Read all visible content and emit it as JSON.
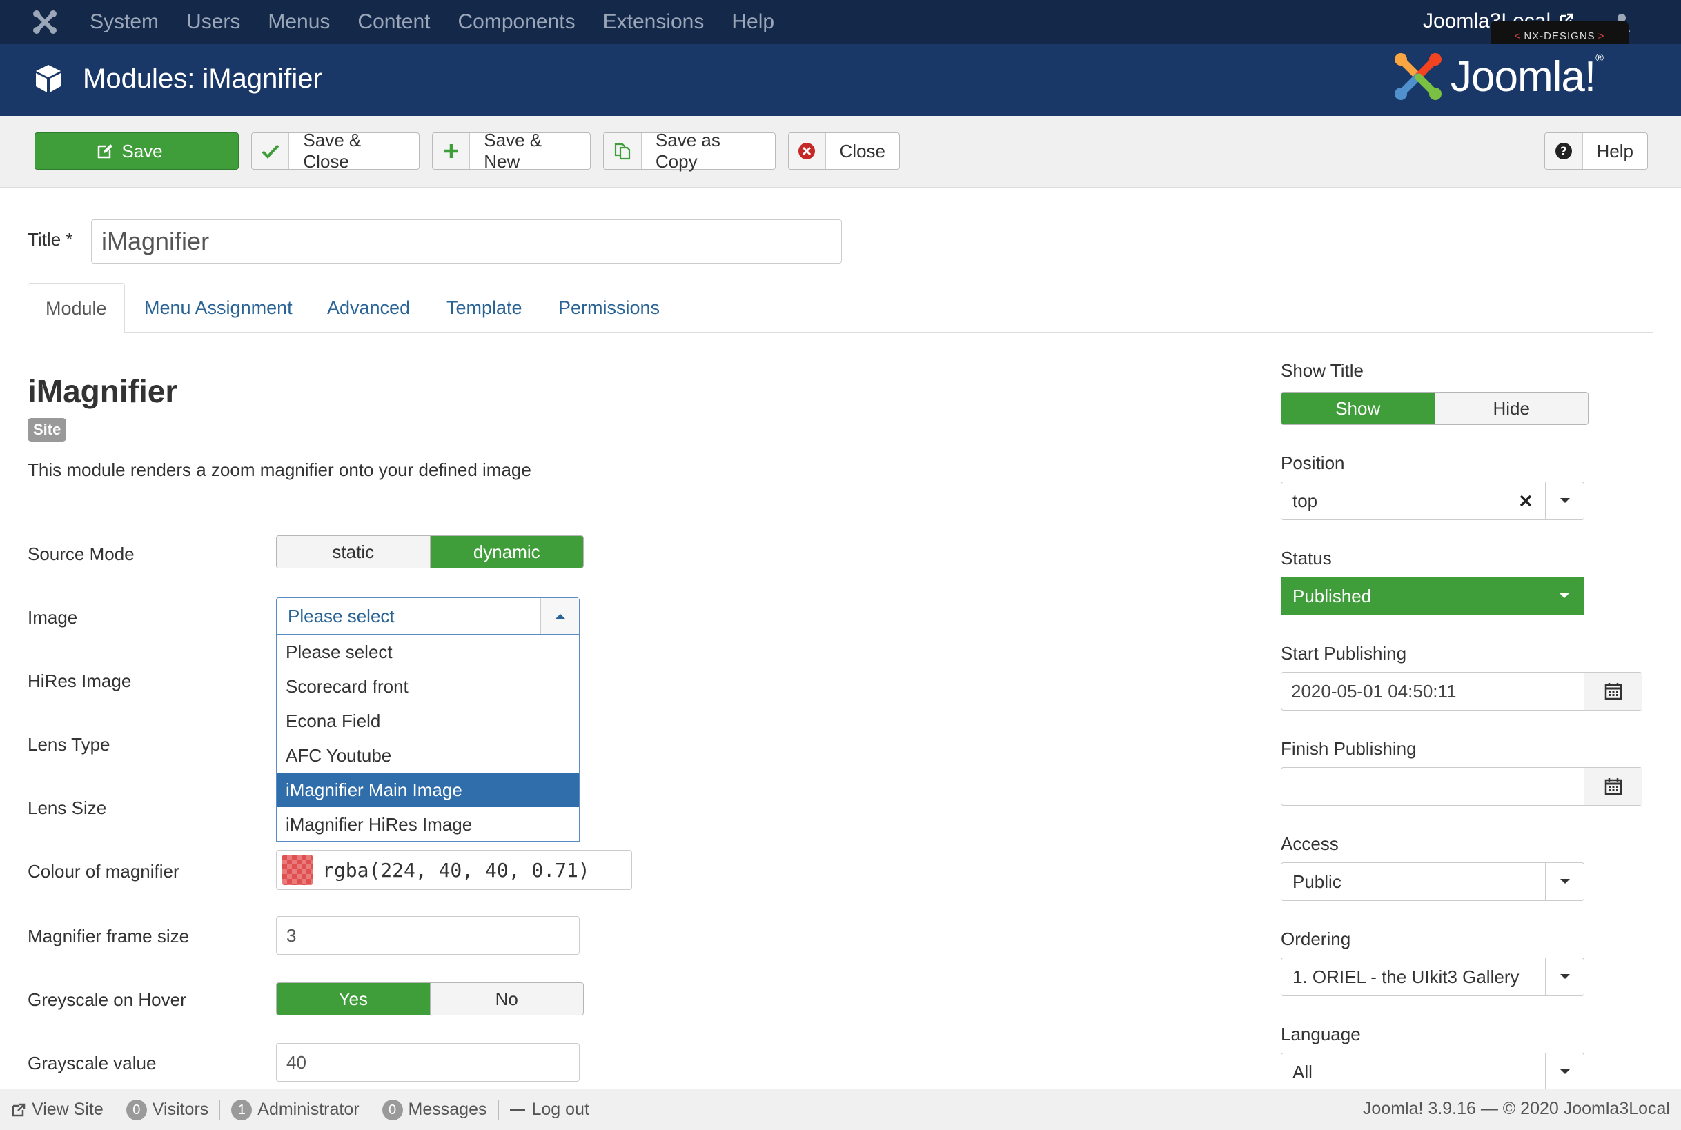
{
  "topnav": {
    "menu": [
      "System",
      "Users",
      "Menus",
      "Content",
      "Components",
      "Extensions",
      "Help"
    ],
    "site_link": "Joomla3Local",
    "badge": "NX-DESIGNS"
  },
  "header": {
    "title": "Modules: iMagnifier",
    "brand": "Joomla!",
    "brand_mark": "®"
  },
  "toolbar": {
    "save": "Save",
    "save_close": "Save & Close",
    "save_new": "Save & New",
    "save_copy": "Save as Copy",
    "close": "Close",
    "help": "Help"
  },
  "form": {
    "title_label": "Title *",
    "title_value": "iMagnifier"
  },
  "tabs": [
    "Module",
    "Menu Assignment",
    "Advanced",
    "Template",
    "Permissions"
  ],
  "module": {
    "name": "iMagnifier",
    "badge": "Site",
    "description": "This module renders a zoom magnifier onto your defined image"
  },
  "fields": {
    "source_mode": {
      "label": "Source Mode",
      "options": [
        "static",
        "dynamic"
      ],
      "selected": "dynamic"
    },
    "image": {
      "label": "Image",
      "value": "Please select",
      "options": [
        "Please select",
        "Scorecard front",
        "Econa Field",
        "AFC Youtube",
        "iMagnifier Main Image",
        "iMagnifier HiRes Image"
      ],
      "highlighted": "iMagnifier Main Image"
    },
    "hires_image": {
      "label": "HiRes Image"
    },
    "lens_type": {
      "label": "Lens Type"
    },
    "lens_size": {
      "label": "Lens Size"
    },
    "colour": {
      "label": "Colour of magnifier",
      "value": "rgba(224, 40, 40, 0.71)"
    },
    "frame_size": {
      "label": "Magnifier frame size",
      "value": "3"
    },
    "greyscale": {
      "label": "Greyscale on Hover",
      "options": [
        "Yes",
        "No"
      ],
      "selected": "Yes"
    },
    "grayscale_value": {
      "label": "Grayscale value",
      "value": "40"
    }
  },
  "sidebar": {
    "show_title": {
      "label": "Show Title",
      "options": [
        "Show",
        "Hide"
      ],
      "selected": "Show"
    },
    "position": {
      "label": "Position",
      "value": "top"
    },
    "status": {
      "label": "Status",
      "value": "Published"
    },
    "start_publishing": {
      "label": "Start Publishing",
      "value": "2020-05-01 04:50:11"
    },
    "finish_publishing": {
      "label": "Finish Publishing",
      "value": ""
    },
    "access": {
      "label": "Access",
      "value": "Public"
    },
    "ordering": {
      "label": "Ordering",
      "value": "1. ORIEL - the UIkit3 Gallery"
    },
    "language": {
      "label": "Language",
      "value": "All"
    }
  },
  "statusbar": {
    "view_site": "View Site",
    "visitors_count": "0",
    "visitors": "Visitors",
    "admin_count": "1",
    "admin": "Administrator",
    "messages_count": "0",
    "messages": "Messages",
    "logout": "Log out",
    "version": "Joomla! 3.9.16  —  © 2020 Joomla3Local"
  },
  "colors": {
    "topnav_bg": "#142849",
    "header_bg": "#1a3867",
    "green": "#3f9d3a",
    "link": "#2a6496",
    "selected_option": "#2f6dab"
  },
  "icons": [
    "joomla-icon",
    "external-link-icon",
    "user-icon",
    "cube-icon",
    "edit-icon",
    "check-icon",
    "plus-icon",
    "copy-icon",
    "close-circle-icon",
    "question-icon",
    "caret-up-icon",
    "caret-down-icon",
    "clear-icon",
    "calendar-icon",
    "minus-icon"
  ]
}
